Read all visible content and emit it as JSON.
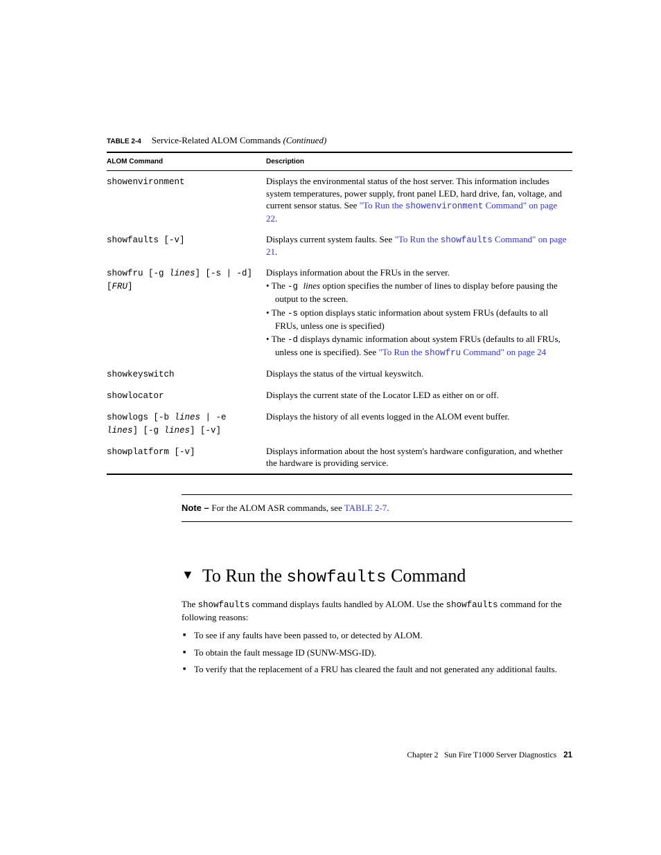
{
  "table": {
    "label": "TABLE 2-4",
    "title": "Service-Related ALOM Commands ",
    "continued": "(Continued)",
    "headers": {
      "c1": "ALOM Command",
      "c2": "Description"
    },
    "rows": {
      "r1": {
        "cmd": "showenvironment",
        "desc_pre": "Displays the environmental status of the host server. This information includes system temperatures, power supply, front panel LED, hard drive, fan, voltage, and current sensor status. See ",
        "link1a": "\"To Run the ",
        "link1b": "showenvironment",
        "link1c": " Command\" on page 22",
        "dot": "."
      },
      "r2": {
        "cmd_a": "showfaults",
        "cmd_b": " [-v]",
        "desc_pre": "Displays current system faults. See ",
        "link_a": "\"To Run the ",
        "link_b": "showfaults",
        "link_c": " Command\" on page 21",
        "dot": "."
      },
      "r3": {
        "cmd_a": "showfru",
        "cmd_b": " [-g ",
        "cmd_c": "lines",
        "cmd_d": "] [-s | -d] [",
        "cmd_e": "FRU",
        "cmd_f": "]",
        "desc_top": "Displays information about the FRUs in the server.",
        "b1_a": "The ",
        "b1_b": "-g ",
        "b1_c": "lines",
        "b1_d": " option specifies the number of lines to display before pausing the output to the screen.",
        "b2_a": "The ",
        "b2_b": "-s",
        "b2_c": " option displays static information about system FRUs (defaults to all FRUs, unless one is specified)",
        "b3_a": "The ",
        "b3_b": "-d",
        "b3_c": " displays dynamic information about system FRUs (defaults to all FRUs, unless one is specified). See ",
        "b3_link_a": "\"To Run the ",
        "b3_link_b": "showfru",
        "b3_link_c": " Command\" on page 24"
      },
      "r4": {
        "cmd": "showkeyswitch",
        "desc": "Displays the status of the virtual keyswitch."
      },
      "r5": {
        "cmd": "showlocator",
        "desc": "Displays the current state of the Locator LED as either on or off."
      },
      "r6": {
        "cmd_a": "showlogs",
        "cmd_b": " [-b ",
        "cmd_c": "lines",
        "cmd_d": " | -e ",
        "cmd_e": "lines",
        "cmd_f": "] [-g ",
        "cmd_g": "lines",
        "cmd_h": "] [-v]",
        "desc": "Displays the history of all events logged in the ALOM event buffer."
      },
      "r7": {
        "cmd_a": "showplatform",
        "cmd_b": " [-v]",
        "desc": "Displays information about the host system's hardware configuration, and whether the hardware is providing service."
      }
    }
  },
  "note": {
    "label": "Note – ",
    "text": "For the ALOM ASR commands, see ",
    "link": "TABLE 2-7",
    "dot": "."
  },
  "section": {
    "heading_a": "To Run the ",
    "heading_b": "showfaults",
    "heading_c": " Command",
    "para_a": "The ",
    "para_b": "showfaults",
    "para_c": " command displays faults handled by ALOM. Use the ",
    "para_d": "showfaults",
    "para_e": " command for the following reasons:",
    "bullets": {
      "i1": "To see if any faults have been passed to, or detected by ALOM.",
      "i2": "To obtain the fault message ID (SUNW-MSG-ID).",
      "i3": "To verify that the replacement of a FRU has cleared the fault and not generated any additional faults."
    }
  },
  "footer": {
    "chapter": "Chapter 2",
    "title": "Sun Fire T1000 Server Diagnostics",
    "page": "21"
  }
}
